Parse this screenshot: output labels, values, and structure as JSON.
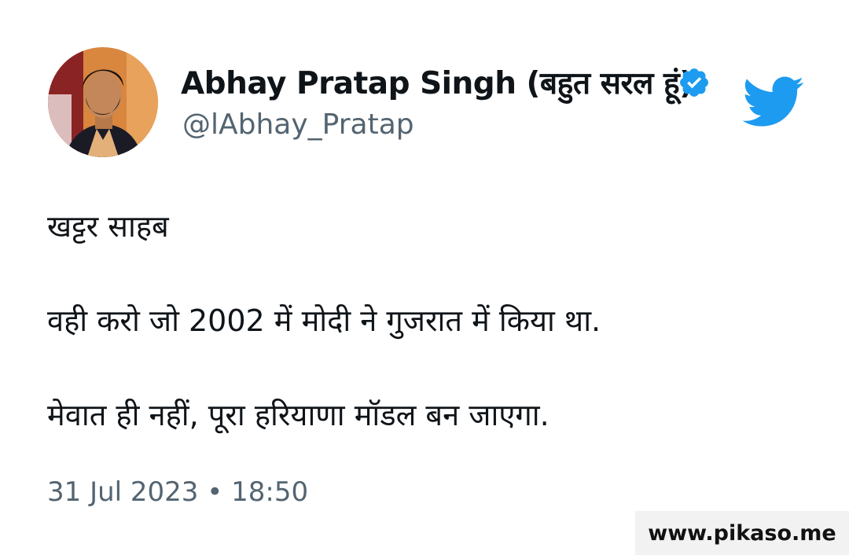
{
  "author": {
    "display_name": "Abhay Pratap Singh (बहुत सरल हूं)",
    "handle": "@lAbhay_Pratap",
    "verified": true,
    "avatar_icon": "profile-photo"
  },
  "tweet": {
    "lines": [
      "खट्टर साहब",
      "वही करो जो 2002 में मोदी ने गुजरात में किया था.",
      "मेवात ही नहीं, पूरा हरियाणा मॉडल बन जाएगा."
    ],
    "timestamp": "31 Jul 2023 • 18:50"
  },
  "watermark": "www.pikaso.me",
  "icons": {
    "brand": "twitter-bird-icon",
    "badge": "verified-badge-icon"
  },
  "colors": {
    "twitter_blue": "#1d9bf0",
    "secondary_text": "#536471",
    "primary_text": "#0f1419"
  }
}
